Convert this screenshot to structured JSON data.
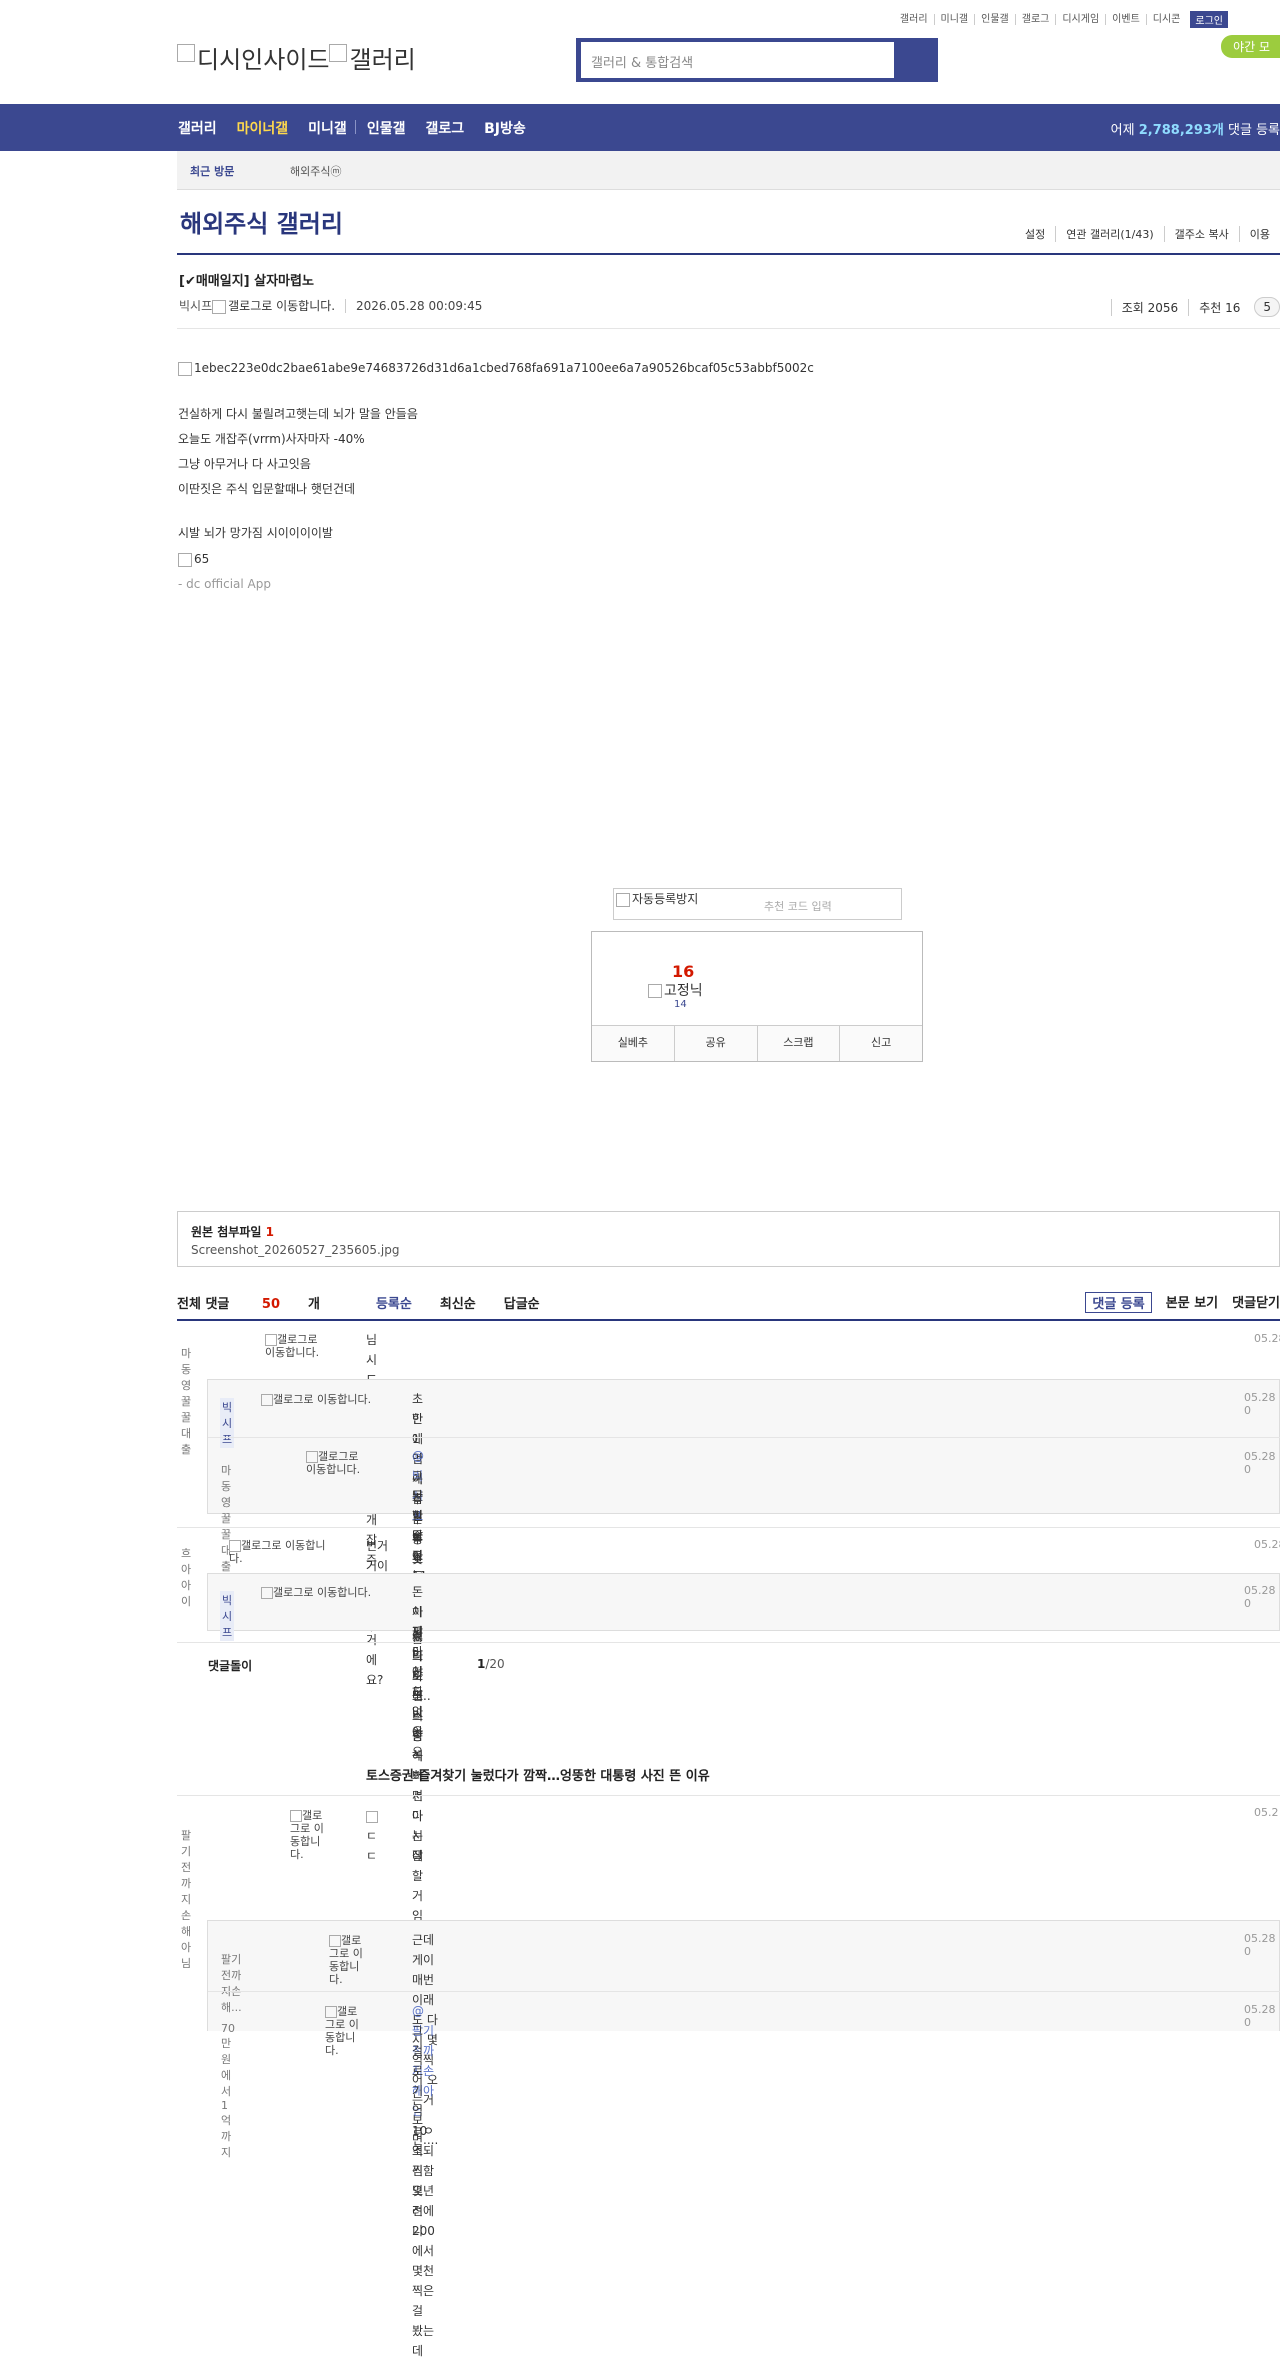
{
  "top_links": [
    "갤러리",
    "미니갤",
    "인물갤",
    "갤로그",
    "디시게임",
    "이벤트",
    "디시콘"
  ],
  "login_label": "로그인",
  "night_label": "야간 모",
  "logo": {
    "part1": "디시인사이드",
    "part2": "갤러리"
  },
  "search": {
    "placeholder": "갤러리 & 통합검색"
  },
  "gnb": {
    "items": [
      "갤러리",
      "마이너갤",
      "미니갤",
      "인물갤"
    ],
    "items2": [
      "갤로그",
      "BJ방송"
    ],
    "stat_prefix": "어제 ",
    "stat_num": "2,788,293개",
    "stat_suffix": " 댓글 등록"
  },
  "recent": {
    "title": "최근 방문",
    "gallery": "해외주식ⓜ"
  },
  "gallery_title": "해외주식 갤러리",
  "gallery_menu": [
    "설정",
    "연관 갤러리(1/43)",
    "갤주소 복사",
    "이용"
  ],
  "post": {
    "title": "[✔매매일지] 살자마렵노",
    "author": "빅시프",
    "author_img_alt": "갤로그로 이동합니다.",
    "date": "2026.05.28 00:09:45",
    "views": "조회 2056",
    "recommend": "추천 16",
    "comment_btn": "5",
    "image_alt": "1ebec223e0dc2bae61abe9e74683726d31d6a1cbed768fa691a7100ee6a7a90526bcaf05c53abbf5002c",
    "lines": [
      "건실하게 다시 불릴려고햇는데 뇌가 말을 안들음",
      "오늘도 개잡주(vrrm)사자마자 -40%",
      "그냥 아무거나 다 사고잇음",
      "이딴짓은 주식 입문할때나 햇던건데"
    ],
    "line5": "시발 뇌가 망가짐 시이이이이발",
    "img65": "65",
    "app": "- dc official App"
  },
  "captcha": {
    "alt": "자동등록방지",
    "placeholder": "추천 코드 입력"
  },
  "rec_box": {
    "count": "16",
    "fix_alt": "고정닉",
    "fix_count": "14",
    "buttons": [
      "실베추",
      "공유",
      "스크랩",
      "신고"
    ]
  },
  "attach": {
    "title": "원본 첨부파일",
    "count": "1",
    "file": "Screenshot_20260527_235605.jpg"
  },
  "comment_tabs": {
    "total_prefix": "전체 댓글 ",
    "total_count": "50",
    "total_suffix": "개",
    "tabs": [
      "등록순",
      "최신순",
      "답글순"
    ]
  },
  "comment_buttons": [
    "댓글 등록",
    "본문 보기",
    "댓글닫기"
  ],
  "comments": [
    {
      "nick": "마동영꿀꿀대출",
      "alt": "갤로그로 이동합니다.",
      "text": [
        "님 시드 불릴때도 전부 개잡주로 불린거에요?"
      ],
      "date": "05.28"
    },
    {
      "nick": "빅시프",
      "alt": "갤로그로 이동합니다.",
      "text": [
        "초반에만 개잡주 주로하고",
        "한 1억이후론 롱숏 주로햇음"
      ],
      "date": "05.28 0"
    },
    {
      "nick": "마동영꿀꿀대출",
      "alt": "갤로그로 이동합니다.",
      "mention": "@빅시프",
      "text": [
        " 나도 11월에 시드 타노스당해봐서 아는데",
        "그냥 한달 정도 어디 갔다오셈..",
        "돈 벌줄 아는사람이니까 머리좀 식히면 다시 잘할거임"
      ],
      "date": "05.28 0"
    },
    {
      "nick": "흐아아이",
      "alt": "갤로그로 이동합니다.",
      "text": [
        "번거 거이 다날라갔누..."
      ],
      "date": "05.28"
    },
    {
      "nick": "빅시프",
      "alt": "갤로그로 이동합니다.",
      "text": [
        "돈 이제 5천도 없음",
        "차 팔아야하나 아오"
      ],
      "date": "05.28 0"
    },
    {
      "nick": "팔기전까지손해아님",
      "alt": "갤로그로 이동합니다.",
      "img_alt": "ㄷㄷ",
      "date": "05.2"
    },
    {
      "nick": "팔기전까지손해...",
      "alt": "갤로그로 이동합니다.",
      "text": [
        "근데 게이 매번 이래도 다시 몇억찍어 오는거보면...."
      ],
      "date": "05.28 0"
    },
    {
      "nick": "70만원에서1억까지",
      "alt": "갤로그로 이동합니다.",
      "mention": "@팔기전까지손해아님",
      "text": [
        " ㄹㅇ 조되긴함 몇년전에 200에서 몇천찍은걸 봤는데",
        "그걸로 기억 10억 찍으려니"
      ],
      "date": "05.28 0"
    }
  ],
  "pager": {
    "label": "댓글돌이",
    "current": "1",
    "total": "/20"
  },
  "ad_title": "토스증권 즐겨찾기 눌렀다가 깜짝…엉뚱한 대통령 사진 뜬 이유",
  "colors": {
    "brand": "#3b4890",
    "accent": "#ffd94c",
    "red": "#d31900"
  }
}
